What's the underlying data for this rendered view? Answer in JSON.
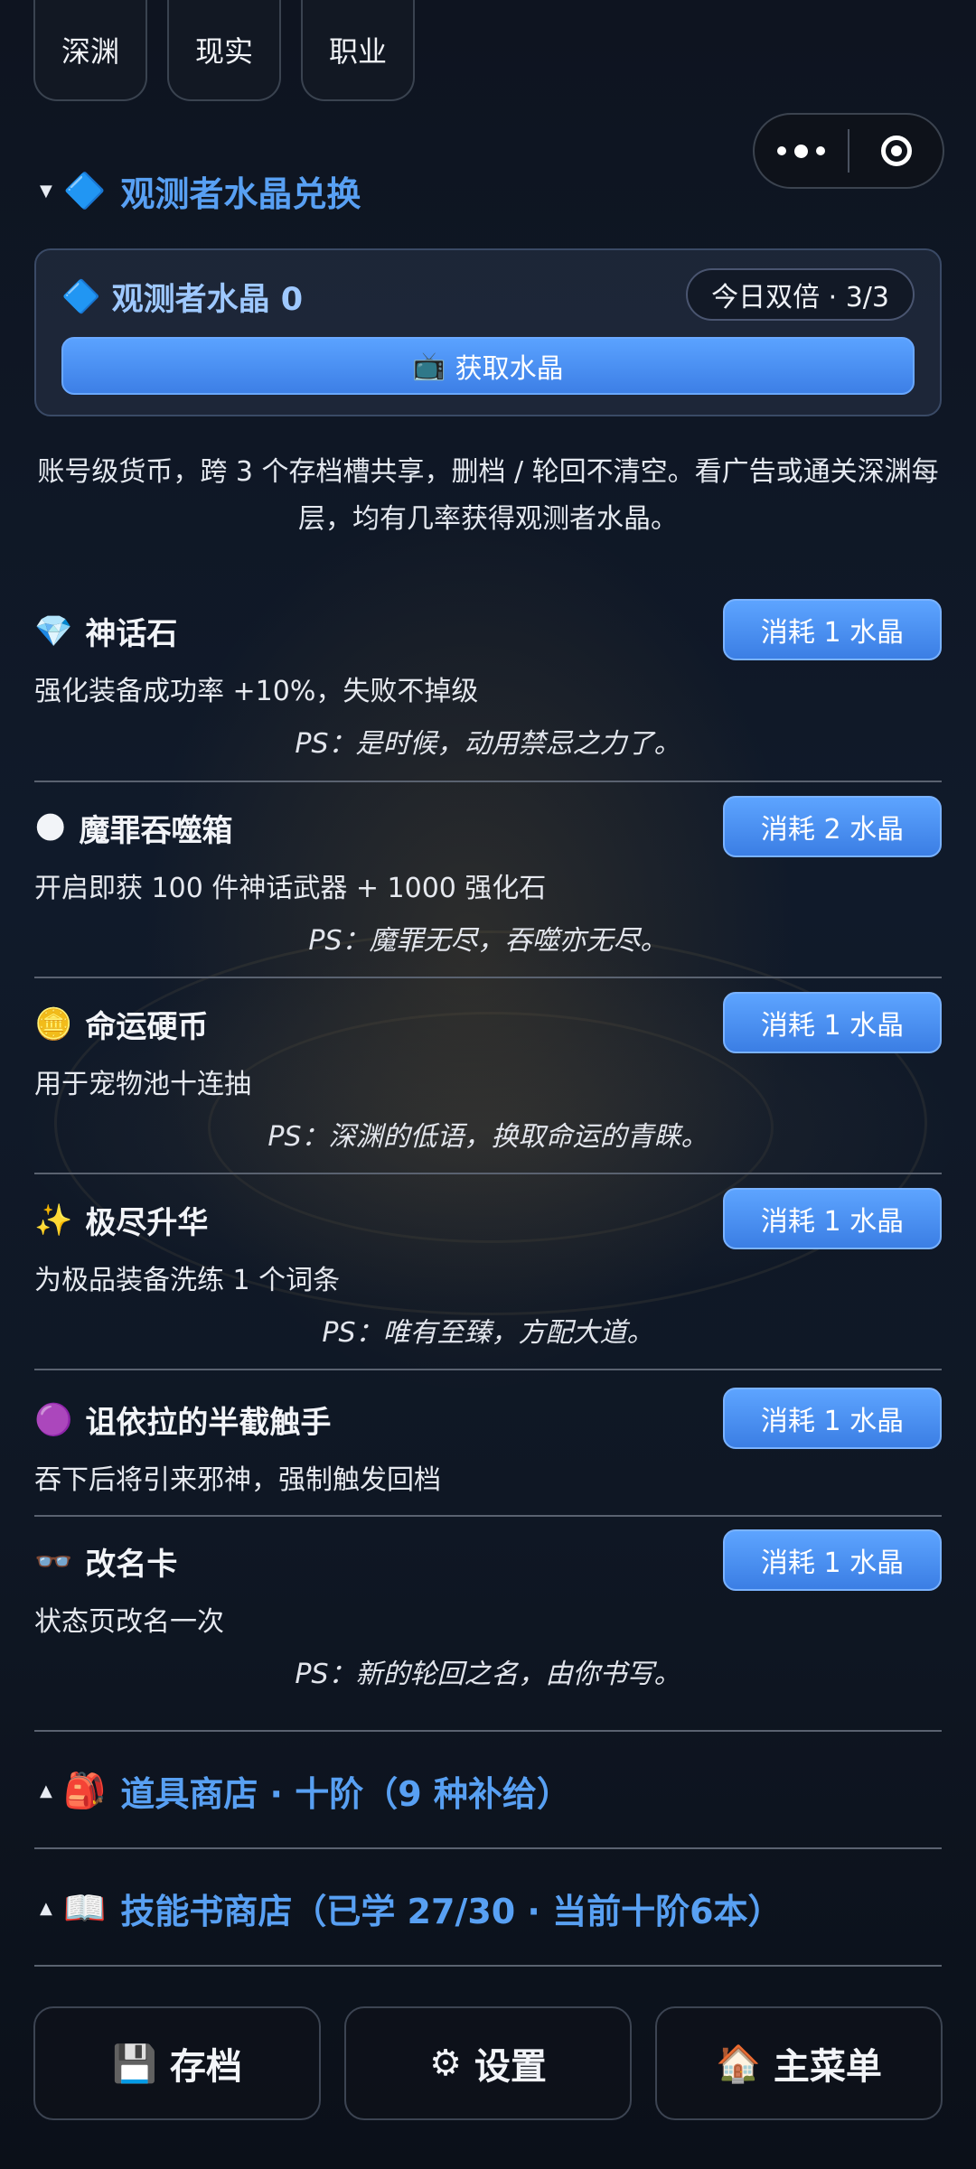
{
  "top_tabs": [
    "深渊",
    "现实",
    "职业"
  ],
  "crystal_section": {
    "caret": "▼",
    "icon": "🔷",
    "title": "观测者水晶兑换",
    "balance_icon": "🔷",
    "balance_label": "观测者水晶 0",
    "badge": "今日双倍 · 3/3",
    "get_button_icon": "📺",
    "get_button": "获取水晶",
    "description": "账号级货币，跨 3 个存档槽共享，删档 / 轮回不清空。看广告或通关深渊每层，均有几率获得观测者水晶。"
  },
  "items": [
    {
      "icon": "💎",
      "name": "神话石",
      "cost": "消耗 1 水晶",
      "desc": "强化装备成功率 +10%，失败不掉级",
      "ps": "PS：是时候，动用禁忌之力了。"
    },
    {
      "icon": "🌑",
      "name": "魔罪吞噬箱",
      "cost": "消耗 2 水晶",
      "desc": "开启即获 100 件神话武器 + 1000 强化石",
      "ps": "PS：魔罪无尽，吞噬亦无尽。"
    },
    {
      "icon": "🪙",
      "name": "命运硬币",
      "cost": "消耗 1 水晶",
      "desc": "用于宠物池十连抽",
      "ps": "PS：深渊的低语，换取命运的青睐。"
    },
    {
      "icon": "✨",
      "name": "极尽升华",
      "cost": "消耗 1 水晶",
      "desc": "为极品装备洗练 1 个词条",
      "ps": "PS：唯有至臻，方配大道。"
    },
    {
      "icon": "🟣",
      "name": "诅依拉的半截触手",
      "cost": "消耗 1 水晶",
      "desc": "吞下后将引来邪神，强制触发回档",
      "ps": ""
    },
    {
      "icon": "👓",
      "name": "改名卡",
      "cost": "消耗 1 水晶",
      "desc": "状态页改名一次",
      "ps": "PS：新的轮回之名，由你书写。"
    }
  ],
  "collapsed_sections": [
    {
      "caret": "▲",
      "icon": "🎒",
      "title": "道具商店 · 十阶（9 种补给）"
    },
    {
      "caret": "▲",
      "icon": "📖",
      "title": "技能书商店（已学 27/30 · 当前十阶6本）"
    }
  ],
  "bottom_bar": [
    {
      "icon": "💾",
      "label": "存档"
    },
    {
      "icon": "⚙",
      "label": "设置"
    },
    {
      "icon": "🏠",
      "label": "主菜单"
    }
  ]
}
